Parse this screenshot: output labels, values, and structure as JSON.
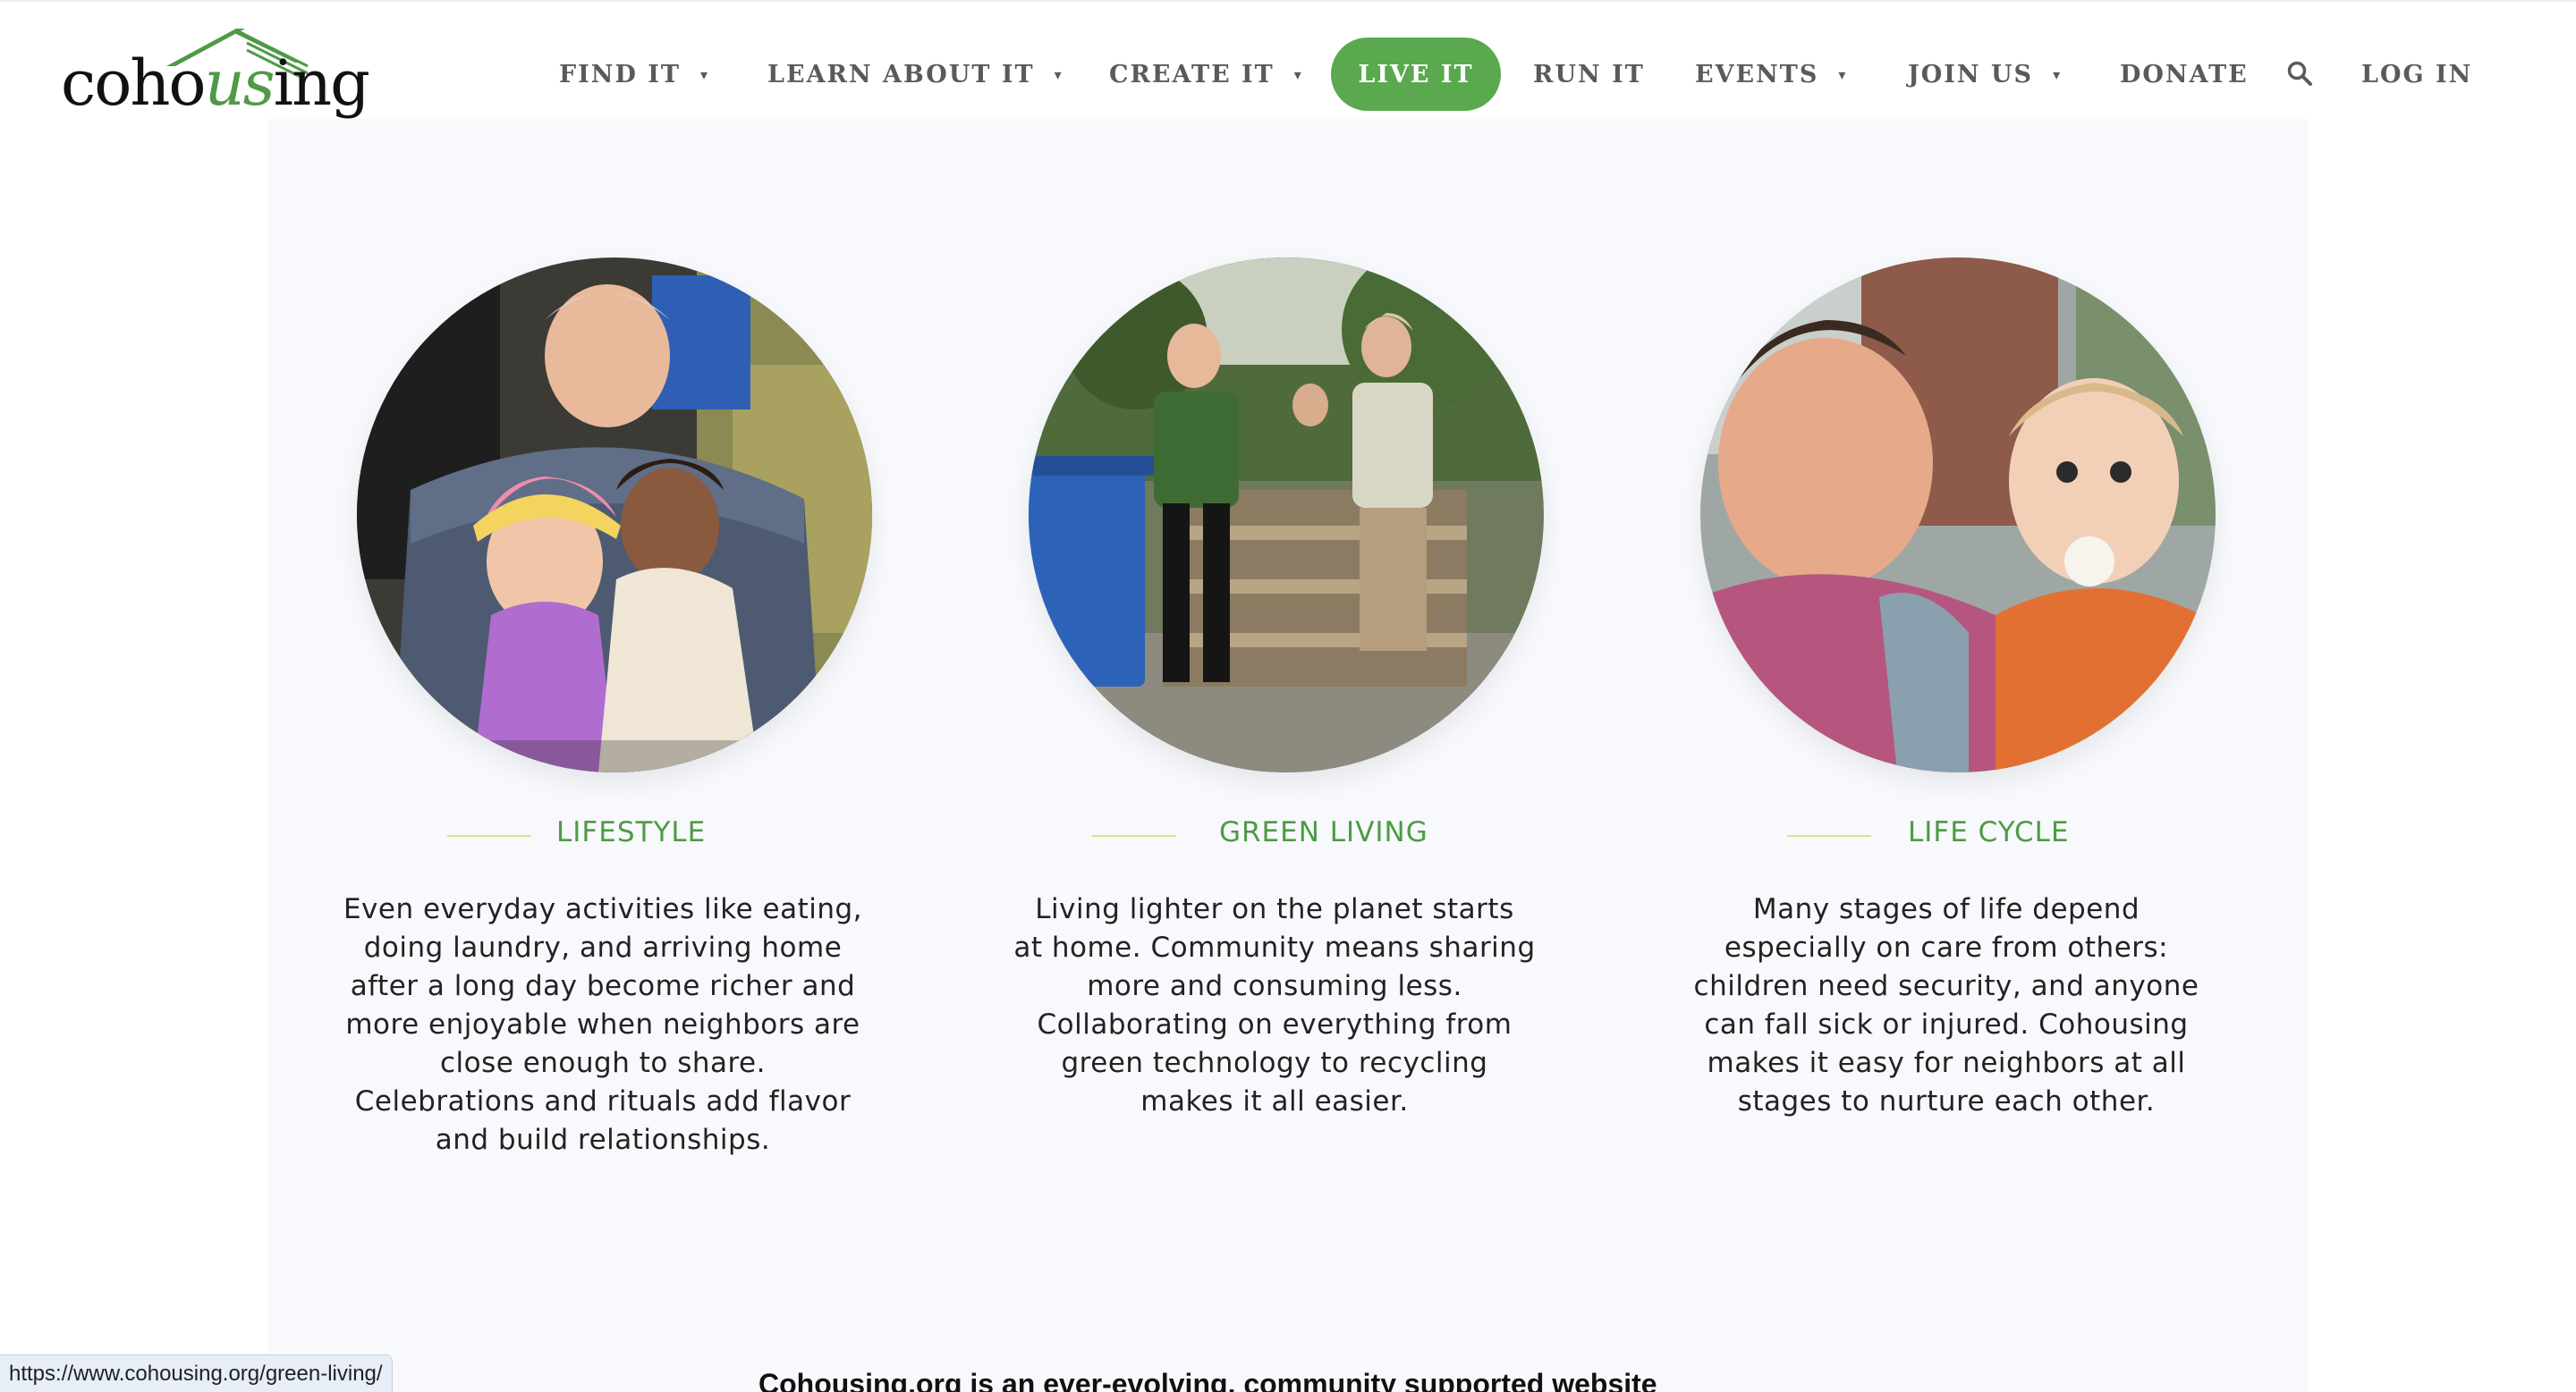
{
  "header": {
    "logo": {
      "text_before": "coho",
      "text_accent": "us",
      "text_after": "ing"
    },
    "nav": [
      {
        "label": "FIND IT",
        "has_dropdown": true
      },
      {
        "label": "LEARN ABOUT IT",
        "has_dropdown": true
      },
      {
        "label": "CREATE IT",
        "has_dropdown": true
      },
      {
        "label": "LIVE IT",
        "has_dropdown": false,
        "active": true
      },
      {
        "label": "RUN IT",
        "has_dropdown": false
      },
      {
        "label": "EVENTS",
        "has_dropdown": true
      },
      {
        "label": "JOIN US",
        "has_dropdown": true
      },
      {
        "label": "DONATE",
        "has_dropdown": false
      },
      {
        "label": "LOG IN",
        "has_dropdown": false
      }
    ],
    "caret_glyph": "▾",
    "search_icon": "search-icon"
  },
  "features": [
    {
      "title": "LIFESTYLE",
      "photo_icon": "photo-lifestyle",
      "text_lines": [
        "Even everyday activities like eating,",
        "doing laundry, and arriving home",
        "after a long day become richer and",
        "more enjoyable when neighbors are",
        "close enough to share.",
        "Celebrations and rituals add flavor",
        "and build relationships."
      ]
    },
    {
      "title": "GREEN LIVING",
      "photo_icon": "photo-green-living",
      "text_lines": [
        "Living lighter on the planet starts",
        "at home. Community means sharing",
        "more and consuming less.",
        "Collaborating on everything from",
        "green technology to recycling",
        "makes it all easier."
      ]
    },
    {
      "title": "LIFE CYCLE",
      "photo_icon": "photo-life-cycle",
      "text_lines": [
        "Many stages of life depend",
        "especially on care from others:",
        "children need security, and anyone",
        "can fall sick or injured. Cohousing",
        "makes it easy for neighbors at all",
        "stages to nurture each other."
      ]
    }
  ],
  "bottom_text": "Cohousing.org is an ever-evolving, community supported website",
  "status_bar": {
    "url": "https://www.cohousing.org/green-living/"
  },
  "colors": {
    "accent_green": "#5aa94f",
    "title_green": "#4e9a45",
    "rule_yellow": "#e3dc8a",
    "panel_bg": "#f7f9fc",
    "nav_text": "#5a5a5a"
  }
}
